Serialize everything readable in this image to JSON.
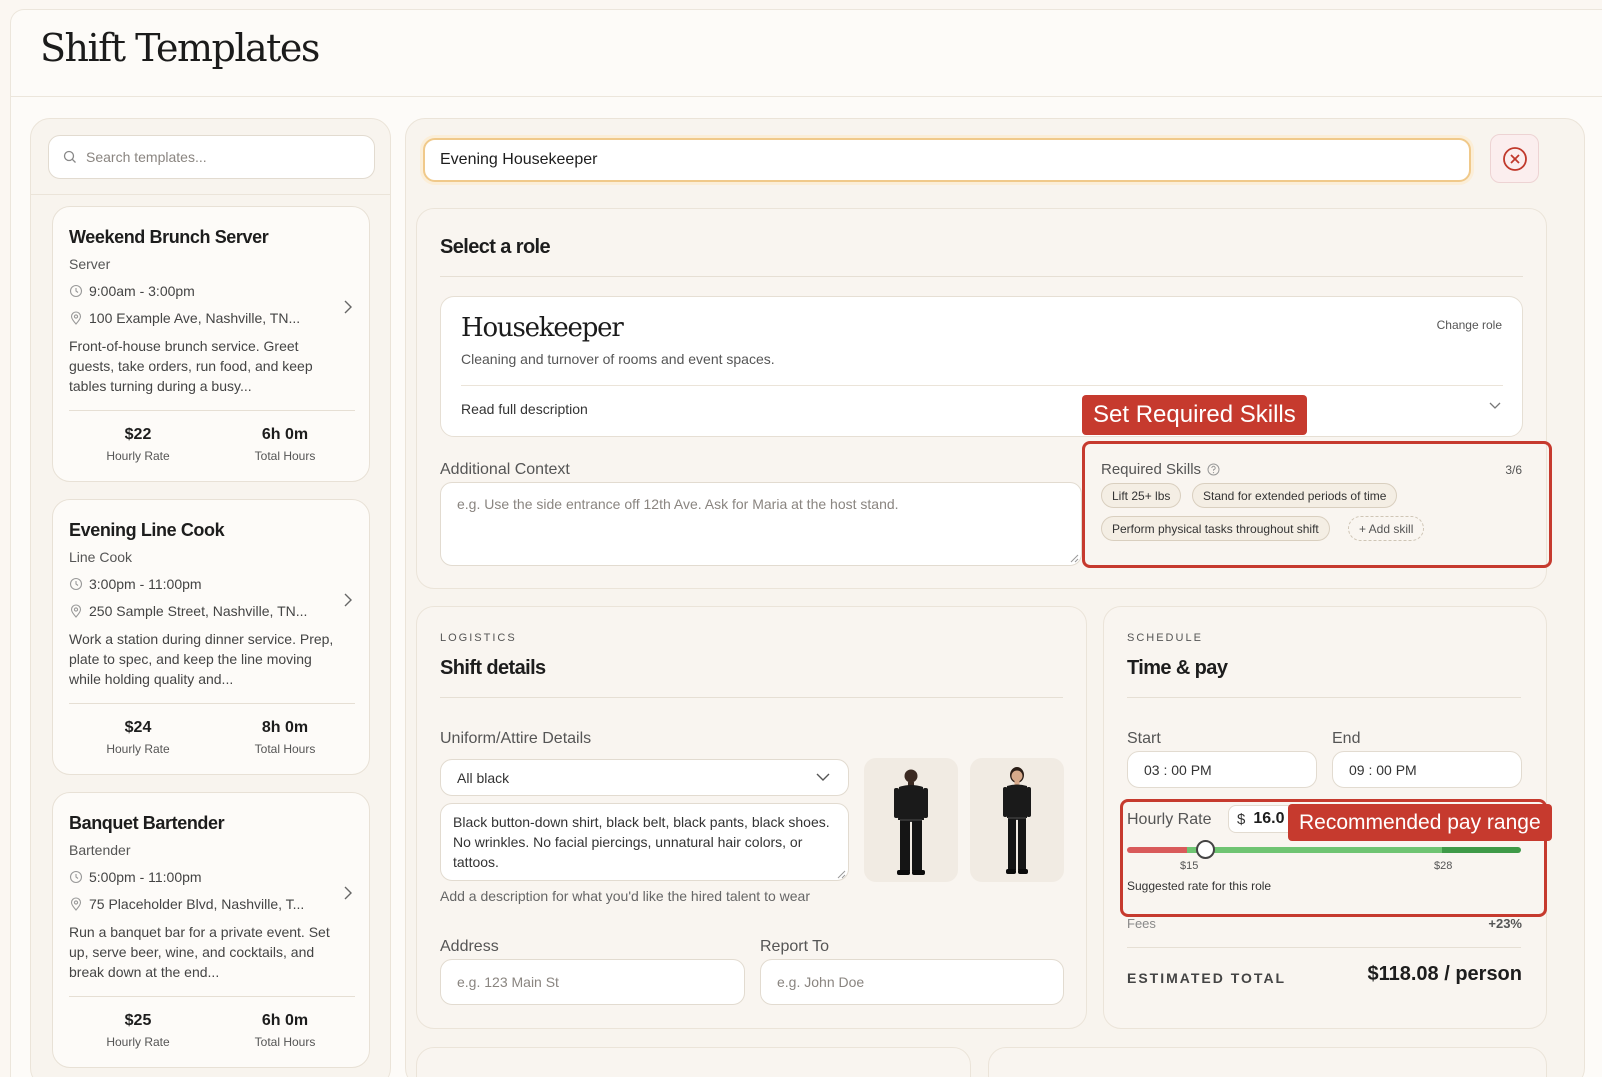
{
  "page": {
    "title": "Shift Templates"
  },
  "search": {
    "placeholder": "Search templates..."
  },
  "templates": [
    {
      "title": "Weekend Brunch Server",
      "role": "Server",
      "time": "9:00am - 3:00pm",
      "location": "100 Example Ave, Nashville, TN...",
      "description": "Front-of-house brunch service. Greet guests, take orders, run food, and keep tables turning during a busy...",
      "rate": "$22",
      "rate_label": "Hourly Rate",
      "hours": "6h 0m",
      "hours_label": "Total Hours"
    },
    {
      "title": "Evening Line Cook",
      "role": "Line Cook",
      "time": "3:00pm - 11:00pm",
      "location": "250 Sample Street, Nashville, TN...",
      "description": "Work a station during dinner service. Prep, plate to spec, and keep the line moving while holding quality and...",
      "rate": "$24",
      "rate_label": "Hourly Rate",
      "hours": "8h 0m",
      "hours_label": "Total Hours"
    },
    {
      "title": "Banquet Bartender",
      "role": "Bartender",
      "time": "5:00pm - 11:00pm",
      "location": "75 Placeholder Blvd, Nashville, T...",
      "description": "Run a banquet bar for a private event. Set up, serve beer, wine, and cocktails, and break down at the end...",
      "rate": "$25",
      "rate_label": "Hourly Rate",
      "hours": "6h 0m",
      "hours_label": "Total Hours"
    }
  ],
  "editor": {
    "name_value": "Evening Housekeeper",
    "role_section": {
      "title": "Select a role",
      "role_name": "Housekeeper",
      "role_description": "Cleaning and turnover of rooms and event spaces.",
      "change_role": "Change role",
      "read_full": "Read full description"
    },
    "context": {
      "label": "Additional Context",
      "placeholder": "e.g. Use the side entrance off 12th Ave. Ask for Maria at the host stand."
    },
    "skills": {
      "label": "Required Skills",
      "count": "3/6",
      "items": [
        "Lift 25+ lbs",
        "Stand for extended periods of time",
        "Perform physical tasks throughout shift"
      ],
      "add_label": "+ Add skill"
    },
    "logistics": {
      "eyebrow": "LOGISTICS",
      "title": "Shift details",
      "uniform_label": "Uniform/Attire Details",
      "uniform_selected": "All black",
      "uniform_text": "Black button-down shirt, black belt, black pants, black shoes. No wrinkles. No facial piercings, unnatural hair colors, or tattoos.",
      "uniform_help": "Add a description for what you'd like the hired talent to wear",
      "address_label": "Address",
      "address_placeholder": "e.g. 123 Main St",
      "report_label": "Report To",
      "report_placeholder": "e.g. John Doe"
    },
    "schedule": {
      "eyebrow": "SCHEDULE",
      "title": "Time & pay",
      "start_label": "Start",
      "start_value": "03 : 00  PM",
      "end_label": "End",
      "end_value": "09 : 00  PM",
      "rate_label": "Hourly Rate",
      "currency": "$",
      "rate_value": "16.0",
      "range_min_label": "$15",
      "range_max_label": "$28",
      "slider_min": 12,
      "slider_max": 32,
      "slider_value": 16,
      "suggested_text": "Suggested rate for this role",
      "fees_label": "Fees",
      "fees_value": "+23%",
      "total_label": "ESTIMATED TOTAL",
      "total_value": "$118.08 / person"
    }
  },
  "annotations": {
    "skills": "Set Required Skills",
    "pay": "Recommended pay range"
  },
  "colors": {
    "annotation": "#c63a2e",
    "slider_low": "#d95a5a",
    "slider_mid": "#6fc472",
    "slider_high": "#3f9a48",
    "focus_ring": "#f0c98a"
  }
}
